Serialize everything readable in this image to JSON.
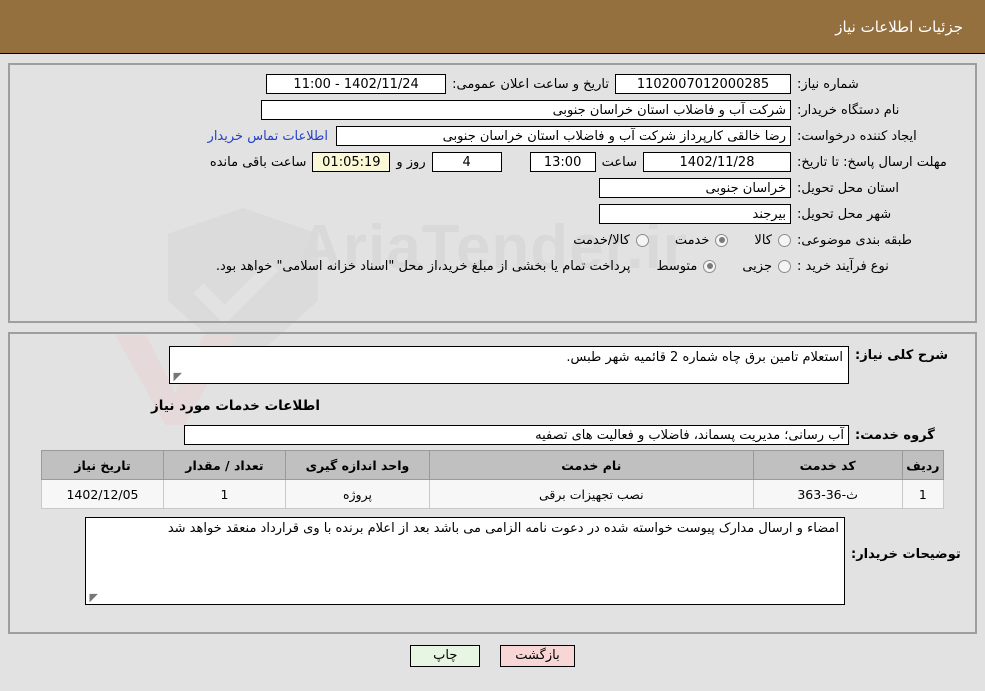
{
  "header": {
    "title": "جزئیات اطلاعات نیاز"
  },
  "watermark": {
    "text": "AriaTender.ir"
  },
  "basic": {
    "need_number_label": "شماره نیاز:",
    "need_number_value": "1102007012000285",
    "announce_label": "تاریخ و ساعت اعلان عمومی:",
    "announce_value": "1402/11/24 - 11:00",
    "buyer_org_label": "نام دستگاه خریدار:",
    "buyer_org_value": "شرکت آب و فاضلاب استان خراسان جنوبی",
    "creator_label": "ایجاد کننده درخواست:",
    "creator_value": "رضا خالقی کارپرداز شرکت آب و فاضلاب استان خراسان جنوبی",
    "contact_link": "اطلاعات تماس خریدار",
    "deadline_label": "مهلت ارسال پاسخ: تا تاریخ:",
    "deadline_date": "1402/11/28",
    "hour_word": "ساعت",
    "deadline_time": "13:00",
    "remaining_days": "4",
    "days_and_word": "روز و",
    "countdown": "01:05:19",
    "remaining_suffix": "ساعت باقی مانده",
    "province_label": "استان محل تحویل:",
    "province_value": "خراسان جنوبی",
    "city_label": "شهر محل تحویل:",
    "city_value": "بیرجند",
    "category_label": "طبقه بندی موضوعی:",
    "category_options": [
      {
        "label": "کالا",
        "selected": false
      },
      {
        "label": "خدمت",
        "selected": true
      },
      {
        "label": "کالا/خدمت",
        "selected": false
      }
    ],
    "process_label": "نوع فرآیند خرید :",
    "process_options": [
      {
        "label": "جزیی",
        "selected": false
      },
      {
        "label": "متوسط",
        "selected": true
      }
    ],
    "process_note": "پرداخت تمام یا بخشی از مبلغ خرید،از محل \"اسناد خزانه اسلامی\" خواهد بود."
  },
  "description": {
    "label": "شرح کلی نیاز:",
    "value": "استعلام تامین برق چاه شماره 2 قائمیه شهر طبس."
  },
  "services": {
    "section_title": "اطلاعات خدمات مورد نیاز",
    "group_label": "گروه خدمت:",
    "group_value": "آب رسانی؛ مدیریت پسماند، فاضلاب و فعالیت های تصفیه",
    "columns": [
      "ردیف",
      "کد خدمت",
      "نام خدمت",
      "واحد اندازه گیری",
      "تعداد / مقدار",
      "تاریخ نیاز"
    ],
    "rows": [
      {
        "radif": "1",
        "code": "ث-36-363",
        "name": "نصب تجهیزات برقی",
        "unit": "پروژه",
        "qty": "1",
        "date": "1402/12/05"
      }
    ]
  },
  "buyer_notes": {
    "label": "توضیحات خریدار:",
    "value": "امضاء و ارسال مدارک پیوست خواسته شده در دعوت نامه الزامی می باشد بعد از اعلام برنده با وی قرارداد منعقد خواهد شد"
  },
  "footer": {
    "back_label": "بازگشت",
    "print_label": "چاپ"
  }
}
